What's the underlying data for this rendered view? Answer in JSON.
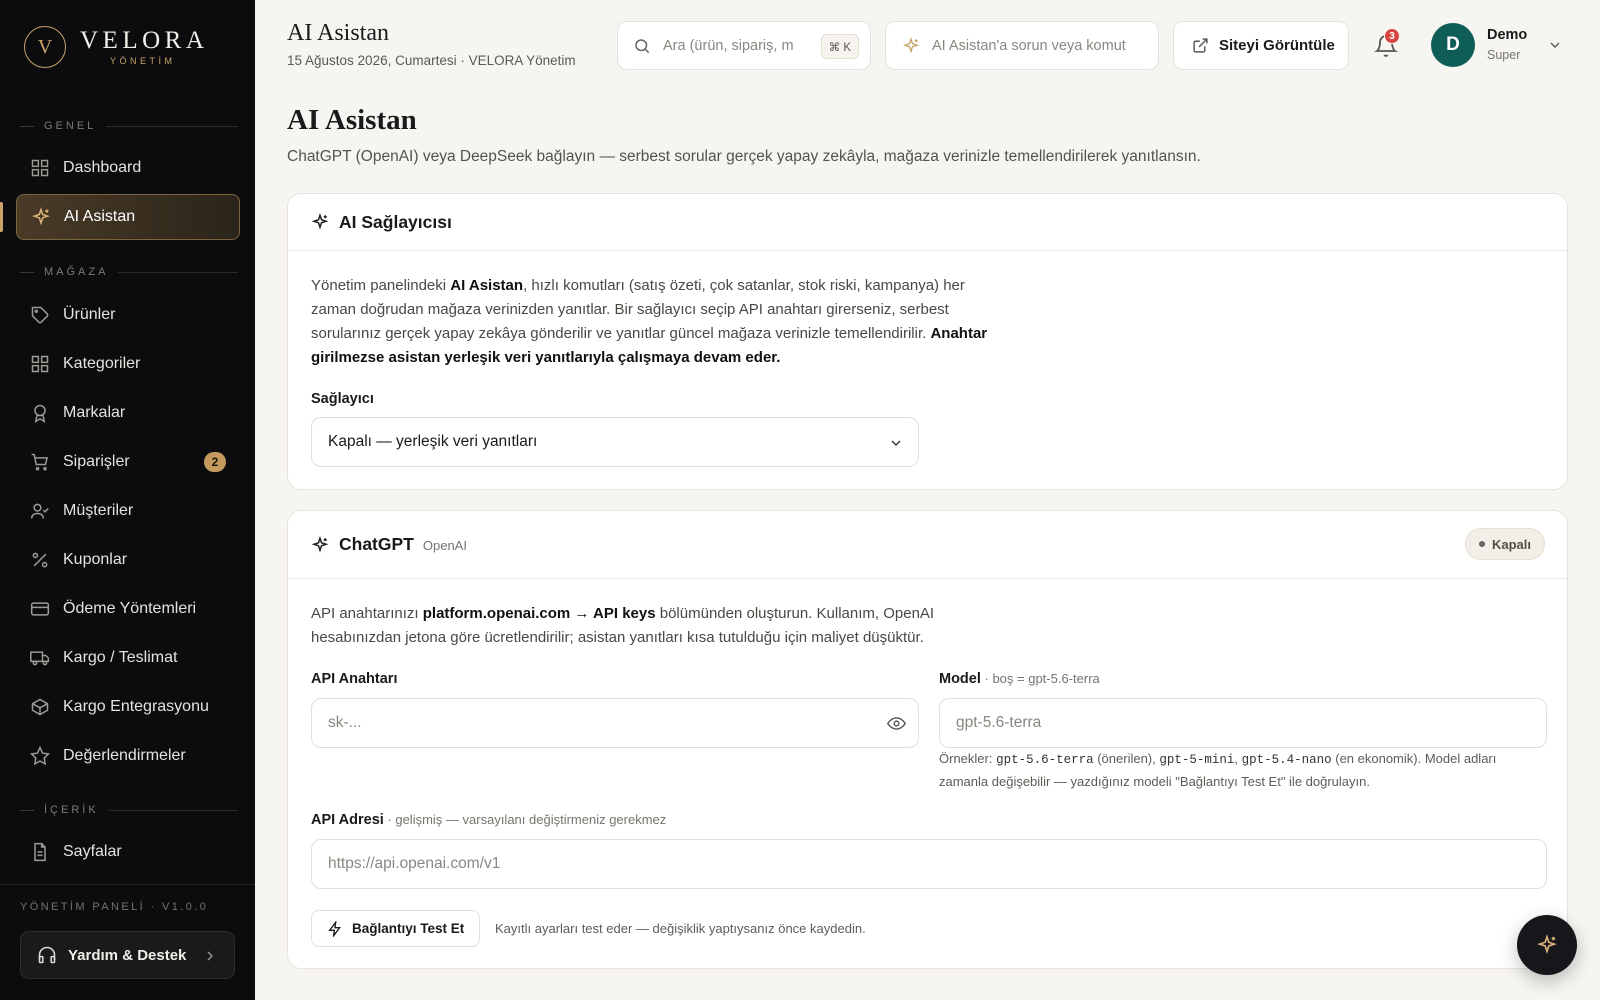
{
  "brand": {
    "mark": "V",
    "name": "VELORA",
    "sub": "YÖNETİM"
  },
  "sidebar": {
    "sections": [
      {
        "label": "GENEL"
      },
      {
        "label": "MAĞAZA"
      },
      {
        "label": "İÇERİK"
      }
    ],
    "items": [
      {
        "label": "Dashboard",
        "icon": "grid-icon"
      },
      {
        "label": "AI Asistan",
        "icon": "sparkle-icon",
        "active": true
      },
      {
        "label": "Ürünler",
        "icon": "tag-icon"
      },
      {
        "label": "Kategoriler",
        "icon": "grid-icon"
      },
      {
        "label": "Markalar",
        "icon": "award-icon"
      },
      {
        "label": "Siparişler",
        "icon": "cart-icon",
        "badge": "2"
      },
      {
        "label": "Müşteriler",
        "icon": "user-check-icon"
      },
      {
        "label": "Kuponlar",
        "icon": "percent-icon"
      },
      {
        "label": "Ödeme Yöntemleri",
        "icon": "card-icon"
      },
      {
        "label": "Kargo / Teslimat",
        "icon": "truck-icon"
      },
      {
        "label": "Kargo Entegrasyonu",
        "icon": "box-icon"
      },
      {
        "label": "Değerlendirmeler",
        "icon": "star-icon"
      },
      {
        "label": "Sayfalar",
        "icon": "file-icon"
      }
    ],
    "footer": "YÖNETİM PANELİ · V1.0.0",
    "help_label": "Yardım & Destek"
  },
  "header": {
    "title": "AI Asistan",
    "subtitle": "15 Ağustos 2026, Cumartesi · VELORA Yönetim",
    "search_placeholder": "Ara (ürün, sipariş, m",
    "search_kbd": "⌘ K",
    "ai_placeholder": "AI Asistan'a sorun veya komut",
    "site_button": "Siteyi Görüntüle",
    "notif_count": "3",
    "user": {
      "initial": "D",
      "name": "Demo",
      "role": "Super"
    }
  },
  "main": {
    "title": "AI Asistan",
    "description": "ChatGPT (OpenAI) veya DeepSeek bağlayın — serbest sorular gerçek yapay zekâyla, mağaza verinizle temellendirilerek yanıtlansın."
  },
  "provider_card": {
    "title": "AI Sağlayıcısı",
    "p_pre": "Yönetim panelindeki ",
    "p_bold1": "AI Asistan",
    "p_mid": ", hızlı komutları (satış özeti, çok satanlar, stok riski, kampanya) her zaman doğrudan mağaza verinizden yanıtlar. Bir sağlayıcı seçip API anahtarı girerseniz, serbest sorularınız gerçek yapay zekâya gönderilir ve yanıtlar güncel mağaza verinizle temellendirilir. ",
    "p_bold2": "Anahtar girilmezse asistan yerleşik veri yanıtlarıyla çalışmaya devam eder.",
    "field_label": "Sağlayıcı",
    "selected": "Kapalı — yerleşik veri yanıtları"
  },
  "chatgpt_card": {
    "title": "ChatGPT",
    "subtitle": "OpenAI",
    "status": "Kapalı",
    "p_pre": "API anahtarınızı ",
    "p_bold1": "platform.openai.com → API keys",
    "p_post": " bölümünden oluşturun. Kullanım, OpenAI hesabınızdan jetona göre ücretlendirilir; asistan yanıtları kısa tutulduğu için maliyet düşüktür.",
    "api_key_label": "API Anahtarı",
    "api_key_placeholder": "sk-...",
    "model_label": "Model",
    "model_hint": " · boş = gpt-5.6-terra",
    "model_placeholder": "gpt-5.6-terra",
    "model_note_pre": "Örnekler: ",
    "model_ex1": "gpt-5.6-terra",
    "model_note_a": " (önerilen), ",
    "model_ex2": "gpt-5-mini",
    "model_note_b": ", ",
    "model_ex3": "gpt-5.4-nano",
    "model_note_c": " (en ekonomik). Model adları zamanla değişebilir — yazdığınız modeli \"Bağlantıyı Test Et\" ile doğrulayın.",
    "api_url_label": "API Adresi",
    "api_url_hint": " · gelişmiş — varsayılanı değiştirmeniz gerekmez",
    "api_url_placeholder": "https://api.openai.com/v1",
    "test_button": "Bağlantıyı Test Et",
    "test_note": "Kayıtlı ayarları test eder — değişiklik yaptıysanız önce kaydedin."
  },
  "colors": {
    "accent": "#c9a36a",
    "sidebar_bg": "#0c0c0e",
    "avatar_bg": "#0f5d57",
    "badge_red": "#d6453d"
  }
}
